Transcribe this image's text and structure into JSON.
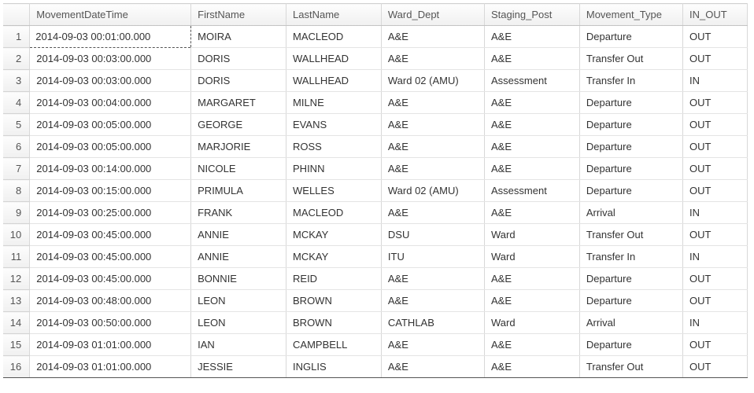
{
  "columns": [
    {
      "key": "MovementDateTime",
      "label": "MovementDateTime",
      "cls": "col-dt"
    },
    {
      "key": "FirstName",
      "label": "FirstName",
      "cls": "col-fn"
    },
    {
      "key": "LastName",
      "label": "LastName",
      "cls": "col-ln"
    },
    {
      "key": "Ward_Dept",
      "label": "Ward_Dept",
      "cls": "col-wd"
    },
    {
      "key": "Staging_Post",
      "label": "Staging_Post",
      "cls": "col-sp"
    },
    {
      "key": "Movement_Type",
      "label": "Movement_Type",
      "cls": "col-mt"
    },
    {
      "key": "IN_OUT",
      "label": "IN_OUT",
      "cls": "col-io"
    }
  ],
  "selected": {
    "row": 0,
    "colKey": "MovementDateTime"
  },
  "rows": [
    {
      "n": "1",
      "MovementDateTime": "2014-09-03 00:01:00.000",
      "FirstName": "MOIRA",
      "LastName": "MACLEOD",
      "Ward_Dept": "A&E",
      "Staging_Post": "A&E",
      "Movement_Type": "Departure",
      "IN_OUT": "OUT"
    },
    {
      "n": "2",
      "MovementDateTime": "2014-09-03 00:03:00.000",
      "FirstName": "DORIS",
      "LastName": "WALLHEAD",
      "Ward_Dept": "A&E",
      "Staging_Post": "A&E",
      "Movement_Type": "Transfer Out",
      "IN_OUT": "OUT"
    },
    {
      "n": "3",
      "MovementDateTime": "2014-09-03 00:03:00.000",
      "FirstName": "DORIS",
      "LastName": "WALLHEAD",
      "Ward_Dept": "Ward 02 (AMU)",
      "Staging_Post": "Assessment",
      "Movement_Type": "Transfer In",
      "IN_OUT": "IN"
    },
    {
      "n": "4",
      "MovementDateTime": "2014-09-03 00:04:00.000",
      "FirstName": "MARGARET",
      "LastName": "MILNE",
      "Ward_Dept": "A&E",
      "Staging_Post": "A&E",
      "Movement_Type": "Departure",
      "IN_OUT": "OUT"
    },
    {
      "n": "5",
      "MovementDateTime": "2014-09-03 00:05:00.000",
      "FirstName": "GEORGE",
      "LastName": "EVANS",
      "Ward_Dept": "A&E",
      "Staging_Post": "A&E",
      "Movement_Type": "Departure",
      "IN_OUT": "OUT"
    },
    {
      "n": "6",
      "MovementDateTime": "2014-09-03 00:05:00.000",
      "FirstName": "MARJORIE",
      "LastName": "ROSS",
      "Ward_Dept": "A&E",
      "Staging_Post": "A&E",
      "Movement_Type": "Departure",
      "IN_OUT": "OUT"
    },
    {
      "n": "7",
      "MovementDateTime": "2014-09-03 00:14:00.000",
      "FirstName": "NICOLE",
      "LastName": "PHINN",
      "Ward_Dept": "A&E",
      "Staging_Post": "A&E",
      "Movement_Type": "Departure",
      "IN_OUT": "OUT"
    },
    {
      "n": "8",
      "MovementDateTime": "2014-09-03 00:15:00.000",
      "FirstName": "PRIMULA",
      "LastName": "WELLES",
      "Ward_Dept": "Ward 02 (AMU)",
      "Staging_Post": "Assessment",
      "Movement_Type": "Departure",
      "IN_OUT": "OUT"
    },
    {
      "n": "9",
      "MovementDateTime": "2014-09-03 00:25:00.000",
      "FirstName": "FRANK",
      "LastName": "MACLEOD",
      "Ward_Dept": "A&E",
      "Staging_Post": "A&E",
      "Movement_Type": "Arrival",
      "IN_OUT": "IN"
    },
    {
      "n": "10",
      "MovementDateTime": "2014-09-03 00:45:00.000",
      "FirstName": "ANNIE",
      "LastName": "MCKAY",
      "Ward_Dept": "DSU",
      "Staging_Post": "Ward",
      "Movement_Type": "Transfer Out",
      "IN_OUT": "OUT"
    },
    {
      "n": "11",
      "MovementDateTime": "2014-09-03 00:45:00.000",
      "FirstName": "ANNIE",
      "LastName": "MCKAY",
      "Ward_Dept": "ITU",
      "Staging_Post": "Ward",
      "Movement_Type": "Transfer In",
      "IN_OUT": "IN"
    },
    {
      "n": "12",
      "MovementDateTime": "2014-09-03 00:45:00.000",
      "FirstName": "BONNIE",
      "LastName": "REID",
      "Ward_Dept": "A&E",
      "Staging_Post": "A&E",
      "Movement_Type": "Departure",
      "IN_OUT": "OUT"
    },
    {
      "n": "13",
      "MovementDateTime": "2014-09-03 00:48:00.000",
      "FirstName": "LEON",
      "LastName": "BROWN",
      "Ward_Dept": "A&E",
      "Staging_Post": "A&E",
      "Movement_Type": "Departure",
      "IN_OUT": "OUT"
    },
    {
      "n": "14",
      "MovementDateTime": "2014-09-03 00:50:00.000",
      "FirstName": "LEON",
      "LastName": "BROWN",
      "Ward_Dept": "CATHLAB",
      "Staging_Post": "Ward",
      "Movement_Type": "Arrival",
      "IN_OUT": "IN"
    },
    {
      "n": "15",
      "MovementDateTime": "2014-09-03 01:01:00.000",
      "FirstName": "IAN",
      "LastName": "CAMPBELL",
      "Ward_Dept": "A&E",
      "Staging_Post": "A&E",
      "Movement_Type": "Departure",
      "IN_OUT": "OUT"
    },
    {
      "n": "16",
      "MovementDateTime": "2014-09-03 01:01:00.000",
      "FirstName": "JESSIE",
      "LastName": "INGLIS",
      "Ward_Dept": "A&E",
      "Staging_Post": "A&E",
      "Movement_Type": "Transfer Out",
      "IN_OUT": "OUT"
    }
  ]
}
